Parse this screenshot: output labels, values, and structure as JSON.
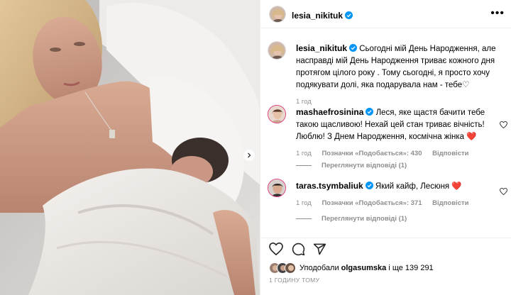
{
  "post": {
    "author": "lesia_nikituk",
    "photo_alt": "",
    "caption": "Сьогодні мій День Народження, але насправді мій День Народження триває кожного дня протягом цілого року . Тому сьогодні, я просто хочу подякувати долі, яка подарувала нам - тебе♡",
    "caption_time": "1 год"
  },
  "comments": [
    {
      "username": "mashaefrosinina",
      "text": "Леся, яке щастя бачити тебе такою щасливою! Нехай цей стан триває вічність! Люблю! З Днем Народження, космічна жінка",
      "emoji": "❤️",
      "time": "1 год",
      "likes": "Позначки «Подобається»: 430",
      "reply": "Відповісти",
      "view_replies": "Переглянути відповіді (1)"
    },
    {
      "username": "taras.tsymbaliuk",
      "text": "Який кайф, Лесюня",
      "emoji": "❤️",
      "time": "1 год",
      "likes": "Позначки «Подобається»: 371",
      "reply": "Відповісти",
      "view_replies": "Переглянути відповіді (1)"
    }
  ],
  "likes": {
    "prefix": "Уподобали",
    "user": "olgasumska",
    "suffix": "і ще 139 291"
  },
  "time_ago": "1 ГОДИНУ ТОМУ",
  "icons": [
    "heart-icon",
    "comment-icon",
    "share-icon",
    "more-icon",
    "verified-icon",
    "chevron-right-icon"
  ],
  "colors": {
    "verified": "#0095f6",
    "heart_red": "#e0245e",
    "meta_gray": "#8e8e8e"
  }
}
